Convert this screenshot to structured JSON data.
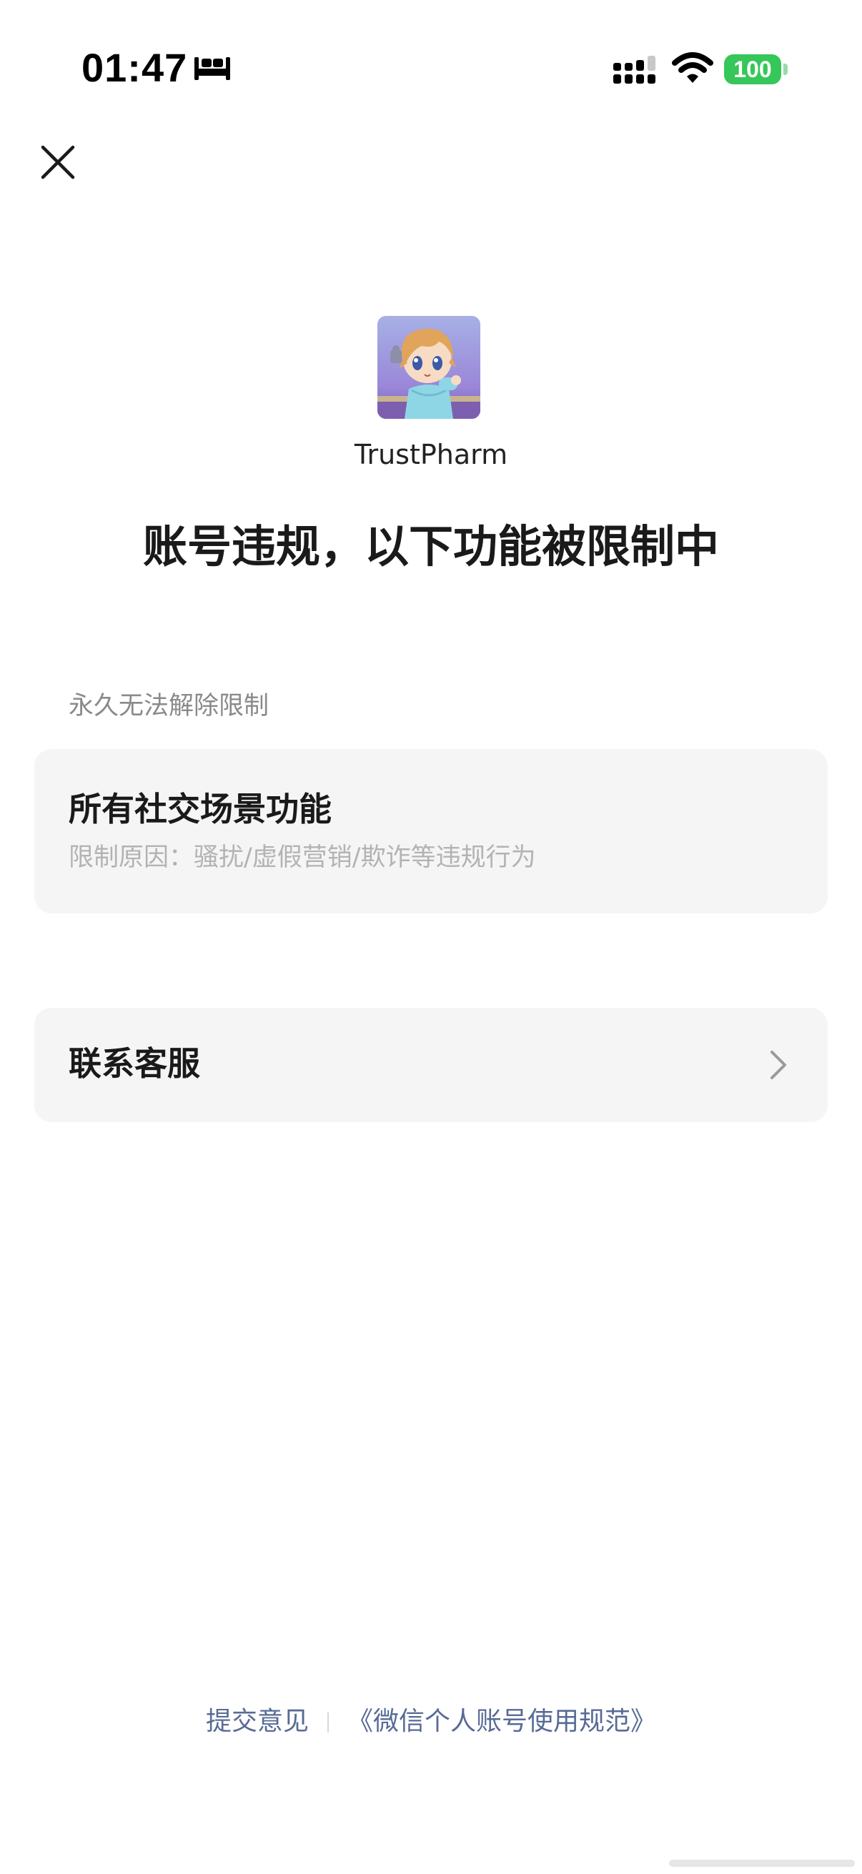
{
  "status_bar": {
    "time": "01:47",
    "battery": "100",
    "icons": [
      "sleep-icon",
      "signal-icon",
      "wifi-icon",
      "battery-icon"
    ]
  },
  "header": {
    "close_icon": "close-icon"
  },
  "account": {
    "name": "TrustPharm"
  },
  "title": "账号违规，以下功能被限制中",
  "restriction_section": {
    "label": "永久无法解除限制",
    "item": {
      "title": "所有社交场景功能",
      "reason": "限制原因：骚扰/虚假营销/欺诈等违规行为"
    }
  },
  "contact": {
    "label": "联系客服",
    "icon": "chevron-right-icon"
  },
  "footer": {
    "feedback": "提交意见",
    "policy": "《微信个人账号使用规范》"
  },
  "colors": {
    "link": "#576b95",
    "battery": "#35c759",
    "card_background": "#f5f5f5"
  }
}
